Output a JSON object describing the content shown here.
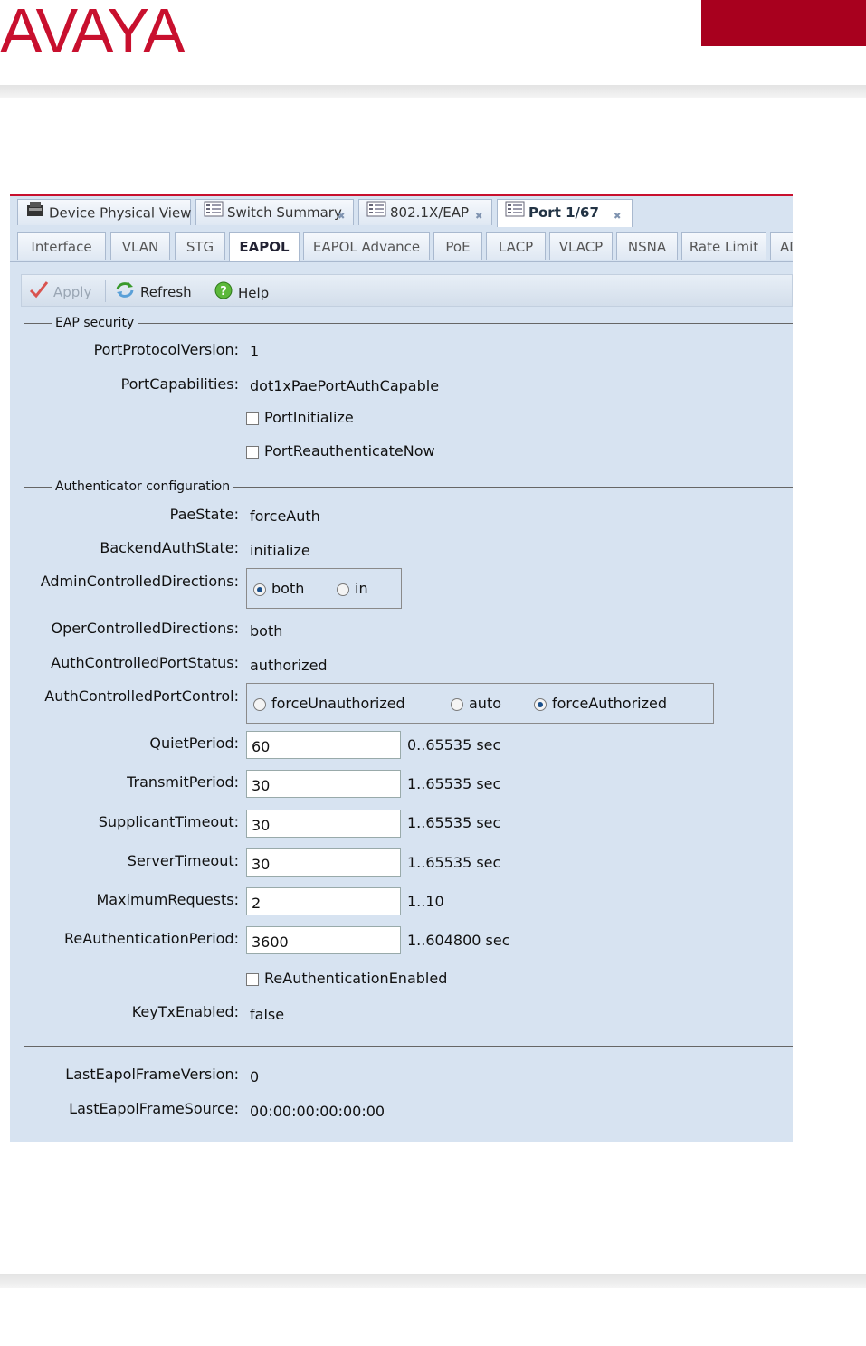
{
  "brand": {
    "logo_text": "AVAYA",
    "logo_color": "#c8102e",
    "block_color": "#a8001e"
  },
  "tabs_top": [
    {
      "label": "Device Physical View",
      "icon": "device-icon",
      "closable": false,
      "active": false
    },
    {
      "label": "Switch Summary",
      "icon": "document-icon",
      "closable": true,
      "active": false
    },
    {
      "label": "802.1X/EAP",
      "icon": "document-icon",
      "closable": true,
      "active": false
    },
    {
      "label": "Port 1/67",
      "icon": "document-icon",
      "closable": true,
      "active": true
    }
  ],
  "tabs_sub": [
    "Interface",
    "VLAN",
    "STG",
    "EAPOL",
    "EAPOL Advance",
    "PoE",
    "LACP",
    "VLACP",
    "NSNA",
    "Rate Limit",
    "AD"
  ],
  "tabs_sub_active": "EAPOL",
  "toolbar": {
    "apply": "Apply",
    "refresh": "Refresh",
    "help": "Help"
  },
  "eap_security": {
    "title": "EAP security",
    "port_protocol_version": {
      "label": "PortProtocolVersion:",
      "value": "1"
    },
    "port_capabilities": {
      "label": "PortCapabilities:",
      "value": "dot1xPaePortAuthCapable"
    },
    "port_initialize": {
      "label": "PortInitialize",
      "checked": false
    },
    "port_reauthenticate_now": {
      "label": "PortReauthenticateNow",
      "checked": false
    }
  },
  "authenticator": {
    "title": "Authenticator configuration",
    "pae_state": {
      "label": "PaeState:",
      "value": "forceAuth"
    },
    "backend_auth_state": {
      "label": "BackendAuthState:",
      "value": "initialize"
    },
    "admin_controlled_directions": {
      "label": "AdminControlledDirections:",
      "options": [
        "both",
        "in"
      ],
      "selected": "both"
    },
    "oper_controlled_directions": {
      "label": "OperControlledDirections:",
      "value": "both"
    },
    "auth_controlled_port_status": {
      "label": "AuthControlledPortStatus:",
      "value": "authorized"
    },
    "auth_controlled_port_control": {
      "label": "AuthControlledPortControl:",
      "options": [
        "forceUnauthorized",
        "auto",
        "forceAuthorized"
      ],
      "selected": "forceAuthorized"
    },
    "quiet_period": {
      "label": "QuietPeriod:",
      "value": "60",
      "range": "0..65535 sec"
    },
    "transmit_period": {
      "label": "TransmitPeriod:",
      "value": "30",
      "range": "1..65535 sec"
    },
    "supplicant_timeout": {
      "label": "SupplicantTimeout:",
      "value": "30",
      "range": "1..65535 sec"
    },
    "server_timeout": {
      "label": "ServerTimeout:",
      "value": "30",
      "range": "1..65535 sec"
    },
    "maximum_requests": {
      "label": "MaximumRequests:",
      "value": "2",
      "range": "1..10"
    },
    "reauthentication_period": {
      "label": "ReAuthenticationPeriod:",
      "value": "3600",
      "range": "1..604800 sec"
    },
    "reauthentication_enabled": {
      "label": "ReAuthenticationEnabled",
      "checked": false
    },
    "key_tx_enabled": {
      "label": "KeyTxEnabled:",
      "value": "false"
    }
  },
  "last_frame": {
    "version": {
      "label": "LastEapolFrameVersion:",
      "value": "0"
    },
    "source": {
      "label": "LastEapolFrameSource:",
      "value": "00:00:00:00:00:00"
    }
  }
}
